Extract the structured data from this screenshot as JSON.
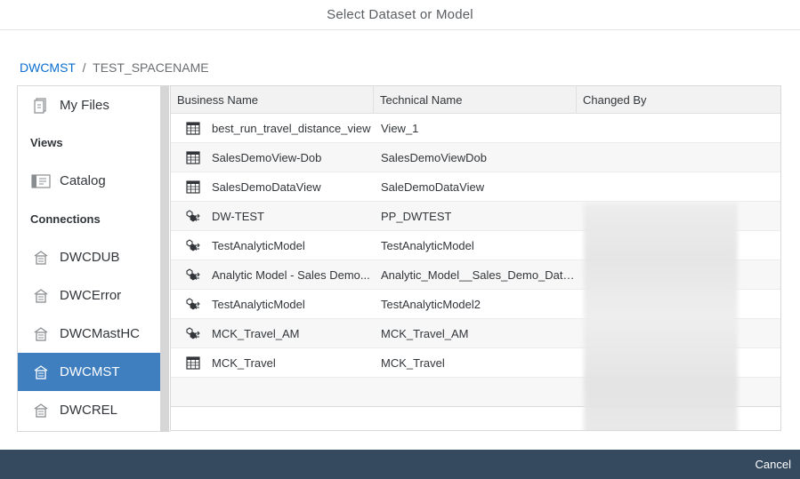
{
  "dialog": {
    "title": "Select Dataset or Model"
  },
  "breadcrumb": {
    "root": "DWCMST",
    "separator": "/",
    "current": "TEST_SPACENAME"
  },
  "sidebar": {
    "my_files": "My Files",
    "views_heading": "Views",
    "catalog": "Catalog",
    "connections_heading": "Connections",
    "connections": [
      {
        "label": "DWCDUB",
        "selected": false
      },
      {
        "label": "DWCError",
        "selected": false
      },
      {
        "label": "DWCMastHC",
        "selected": false
      },
      {
        "label": "DWCMST",
        "selected": true
      },
      {
        "label": "DWCREL",
        "selected": false
      }
    ]
  },
  "table": {
    "headers": {
      "business_name": "Business Name",
      "technical_name": "Technical Name",
      "changed_by": "Changed By"
    },
    "rows": [
      {
        "business_name": "best_run_travel_distance_view",
        "technical_name": "View_1",
        "icon": "view-icon"
      },
      {
        "business_name": "SalesDemoView-Dob",
        "technical_name": "SalesDemoViewDob",
        "icon": "view-icon"
      },
      {
        "business_name": "SalesDemoDataView",
        "technical_name": "SaleDemoDataView",
        "icon": "view-icon"
      },
      {
        "business_name": "DW-TEST",
        "technical_name": "PP_DWTEST",
        "icon": "analytic-model-icon"
      },
      {
        "business_name": "TestAnalyticModel",
        "technical_name": "TestAnalyticModel",
        "icon": "analytic-model-icon"
      },
      {
        "business_name": "Analytic Model - Sales Demo...",
        "technical_name": "Analytic_Model__Sales_Demo_Data_v",
        "icon": "analytic-model-icon"
      },
      {
        "business_name": "TestAnalyticModel",
        "technical_name": "TestAnalyticModel2",
        "icon": "analytic-model-icon"
      },
      {
        "business_name": "MCK_Travel_AM",
        "technical_name": "MCK_Travel_AM",
        "icon": "analytic-model-icon"
      },
      {
        "business_name": "MCK_Travel",
        "technical_name": "MCK_Travel",
        "icon": "view-icon"
      }
    ]
  },
  "footer": {
    "cancel_label": "Cancel"
  },
  "colors": {
    "accent": "#3f7fbf",
    "link": "#0a6ed1",
    "footer": "#354a5f"
  }
}
